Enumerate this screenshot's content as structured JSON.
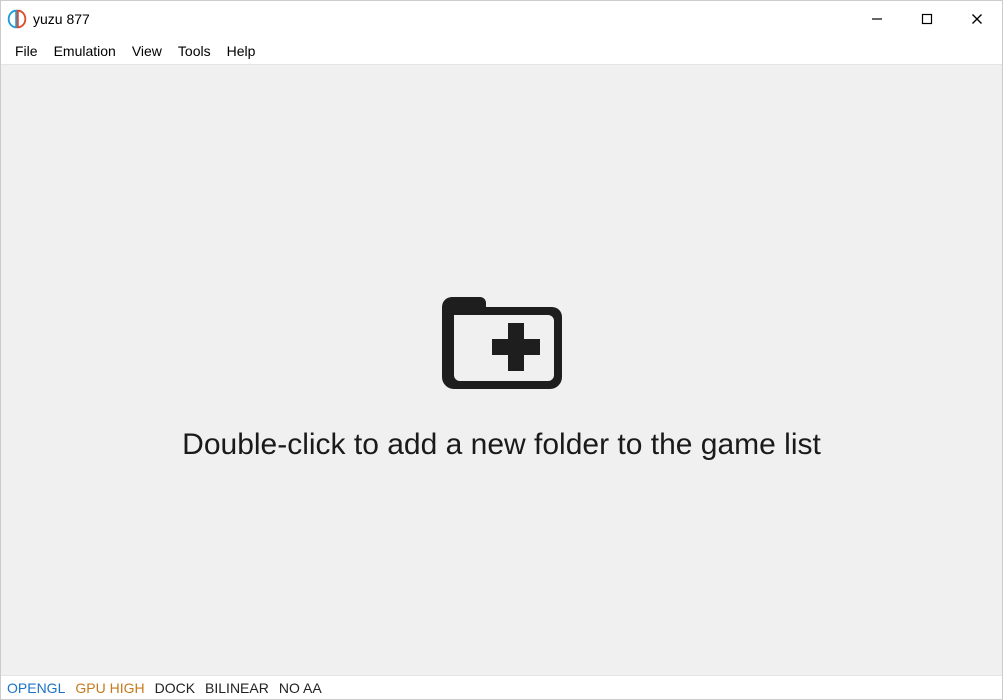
{
  "window": {
    "title": "yuzu 877"
  },
  "menu": {
    "items": [
      "File",
      "Emulation",
      "View",
      "Tools",
      "Help"
    ]
  },
  "main": {
    "empty_prompt": "Double-click to add a new folder to the game list"
  },
  "status": {
    "renderer": "OPENGL",
    "gpu_accuracy": "GPU HIGH",
    "dock_mode": "DOCK",
    "filter": "BILINEAR",
    "aa": "NO AA"
  }
}
